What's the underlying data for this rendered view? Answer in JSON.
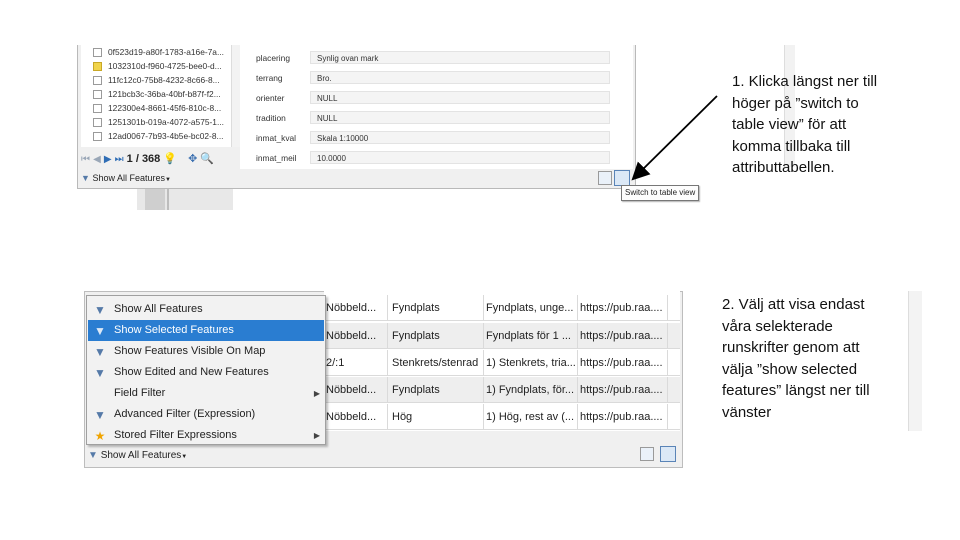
{
  "top_screenshot": {
    "feature_list": [
      {
        "id": "0f523d19-a80f-1783-a16e-7a...",
        "selected": false
      },
      {
        "id": "1032310d-f960-4725-bee0-d...",
        "selected": true
      },
      {
        "id": "11fc12c0-75b8-4232-8c66-8...",
        "selected": false
      },
      {
        "id": "121bcb3c-36ba-40bf-b87f-f2...",
        "selected": false
      },
      {
        "id": "122300e4-8661-45f6-810c-8...",
        "selected": false
      },
      {
        "id": "1251301b-019a-4072-a575-1...",
        "selected": false
      },
      {
        "id": "12ad0067-7b93-4b5e-bc02-8...",
        "selected": false
      }
    ],
    "navigation": {
      "counter": "1 / 368"
    },
    "form_fields": [
      {
        "label": "placering",
        "value": "Synlig ovan mark"
      },
      {
        "label": "terrang",
        "value": "Bro."
      },
      {
        "label": "orienter",
        "value": "NULL"
      },
      {
        "label": "tradition",
        "value": "NULL"
      },
      {
        "label": "inmat_kval",
        "value": "Skala 1:10000"
      },
      {
        "label": "inmat_meil",
        "value": "10.0000"
      }
    ],
    "filter_button": {
      "label": "Show All Features"
    },
    "tooltip": "Switch to table view"
  },
  "bottom_screenshot": {
    "table_rows": [
      {
        "c1": "Nöbbeld...",
        "c2": "Fyndplats",
        "c3": "Fyndplats, unge...",
        "c4": "https://pub.raa...."
      },
      {
        "c1": "Nöbbeld...",
        "c2": "Fyndplats",
        "c3": "Fyndplats för 1 ...",
        "c4": "https://pub.raa...."
      },
      {
        "c1": "2/:1",
        "c2": "Stenkrets/stenrad",
        "c3": "1) Stenkrets, tria...",
        "c4": "https://pub.raa...."
      },
      {
        "c1": "Nöbbeld...",
        "c2": "Fyndplats",
        "c3": "1) Fyndplats, för...",
        "c4": "https://pub.raa...."
      },
      {
        "c1": "Nöbbeld...",
        "c2": "Hög",
        "c3": "1) Hög, rest av (...",
        "c4": "https://pub.raa...."
      }
    ],
    "menu_items": [
      {
        "label": "Show All Features",
        "icon": "filter-icon",
        "highlighted": false,
        "submenu": false
      },
      {
        "label": "Show Selected Features",
        "icon": "filter-icon",
        "highlighted": true,
        "submenu": false
      },
      {
        "label": "Show Features Visible On Map",
        "icon": "filter-icon",
        "highlighted": false,
        "submenu": false
      },
      {
        "label": "Show Edited and New Features",
        "icon": "filter-icon",
        "highlighted": false,
        "submenu": false
      },
      {
        "label": "Field Filter",
        "icon": "none",
        "highlighted": false,
        "submenu": true
      },
      {
        "label": "Advanced Filter (Expression)",
        "icon": "filter-icon",
        "highlighted": false,
        "submenu": false
      },
      {
        "label": "Stored Filter Expressions",
        "icon": "star-icon",
        "highlighted": false,
        "submenu": true
      }
    ],
    "filter_button": {
      "label": "Show All Features"
    }
  },
  "instructions": {
    "step1": "1. Klicka längst ner till\nhöger på ”switch to\ntable view” för att\nkomma tillbaka till\nattributtabellen.",
    "step2": "2. Välj att visa endast\nvåra selekterade\nrunskrifter genom att\nvälja ”show selected\nfeatures” längst ner till\nvänster"
  },
  "colors": {
    "highlight": "#2a7dd1",
    "selected_feature": "#f1d44b",
    "filter_icon": "#557aa8",
    "star_icon": "#f0a400"
  }
}
